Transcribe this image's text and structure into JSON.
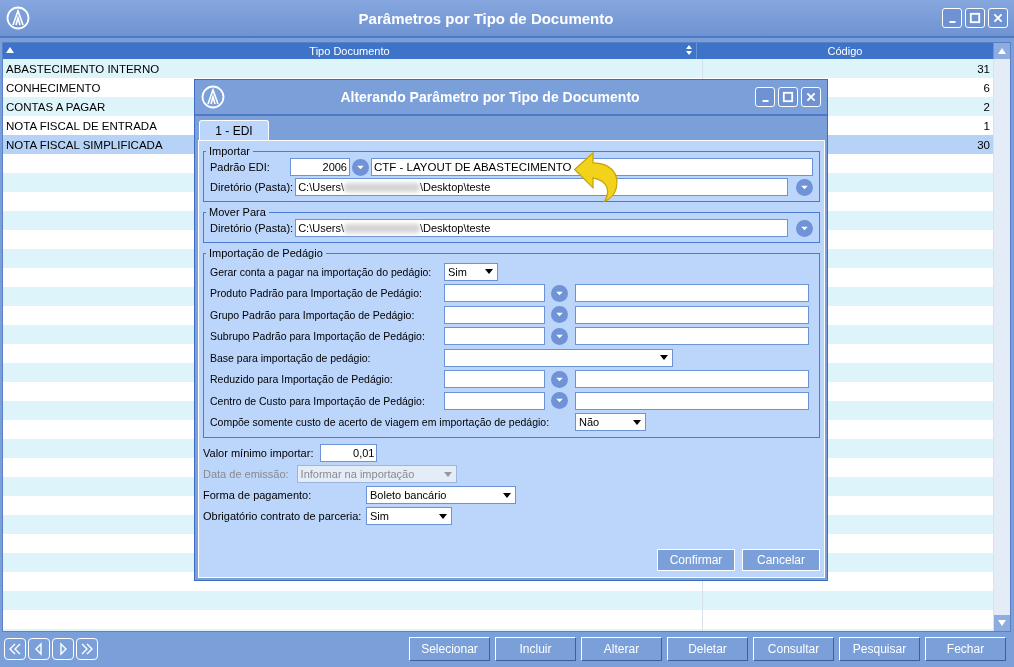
{
  "window": {
    "title": "Parâmetros por Tipo de Documento"
  },
  "table": {
    "columns": [
      "Tipo Documento",
      "Código"
    ],
    "rows": [
      {
        "tipo": "ABASTECIMENTO INTERNO",
        "codigo": "31",
        "selected": false
      },
      {
        "tipo": "CONHECIMENTO",
        "codigo": "6",
        "selected": false
      },
      {
        "tipo": "CONTAS A PAGAR",
        "codigo": "2",
        "selected": false
      },
      {
        "tipo": "NOTA FISCAL DE ENTRADA",
        "codigo": "1",
        "selected": false
      },
      {
        "tipo": "NOTA FISCAL SIMPLIFICADA",
        "codigo": "30",
        "selected": true
      }
    ]
  },
  "dialog": {
    "title": "Alterando Parâmetro por Tipo de Documento",
    "tabs": [
      {
        "label": "1 - EDI",
        "selected": true
      }
    ],
    "importar": {
      "legend": "Importar",
      "padrao_label": "Padrão EDI:",
      "padrao_code": "2006",
      "padrao_name": "CTF - LAYOUT DE ABASTECIMENTO",
      "dir_label": "Diretório (Pasta):",
      "dir_start": "C:\\Users\\",
      "dir_end": "\\Desktop\\teste"
    },
    "mover": {
      "legend": "Mover Para",
      "dir_label": "Diretório (Pasta):",
      "dir_start": "C:\\Users\\",
      "dir_end": "\\Desktop\\teste"
    },
    "pedagio": {
      "legend": "Importação de Pedágio",
      "rows": [
        {
          "kind": "short-select",
          "label": "Gerar conta a pagar na importação do pedágio:",
          "value": "Sim"
        },
        {
          "kind": "lookup",
          "label": "Produto Padrão para Importação de Pedágio:"
        },
        {
          "kind": "lookup",
          "label": "Grupo Padrão para Importação de Pedágio:"
        },
        {
          "kind": "lookup",
          "label": "Subrupo Padrão para Importação de Pedágio:"
        },
        {
          "kind": "wide-select",
          "label": "Base para importação de pedágio:"
        },
        {
          "kind": "lookup",
          "label": "Reduzido para Importação de Pedágio:"
        },
        {
          "kind": "lookup",
          "label": "Centro de Custo para Importação de Pedágio:"
        },
        {
          "kind": "inline-select",
          "label": "Compõe somente custo de acerto de viagem em importação de pedágio:",
          "value": "Não"
        }
      ]
    },
    "extra": [
      {
        "kind": "number",
        "label": "Valor mínimo importar:",
        "value": "0,01",
        "disabled": false
      },
      {
        "kind": "select",
        "label": "Data de emissão:",
        "value": "Informar na importação",
        "disabled": true
      },
      {
        "kind": "select",
        "label": "Forma de pagamento:",
        "value": "Boleto bancário",
        "disabled": false
      },
      {
        "kind": "select",
        "label": "Obrigatório contrato de parceria:",
        "value": "Sim",
        "disabled": false
      }
    ],
    "buttons": [
      "Confirmar",
      "Cancelar"
    ]
  },
  "actions": [
    "Selecionar",
    "Incluir",
    "Alterar",
    "Deletar",
    "Consultar",
    "Pesquisar",
    "Fechar"
  ]
}
